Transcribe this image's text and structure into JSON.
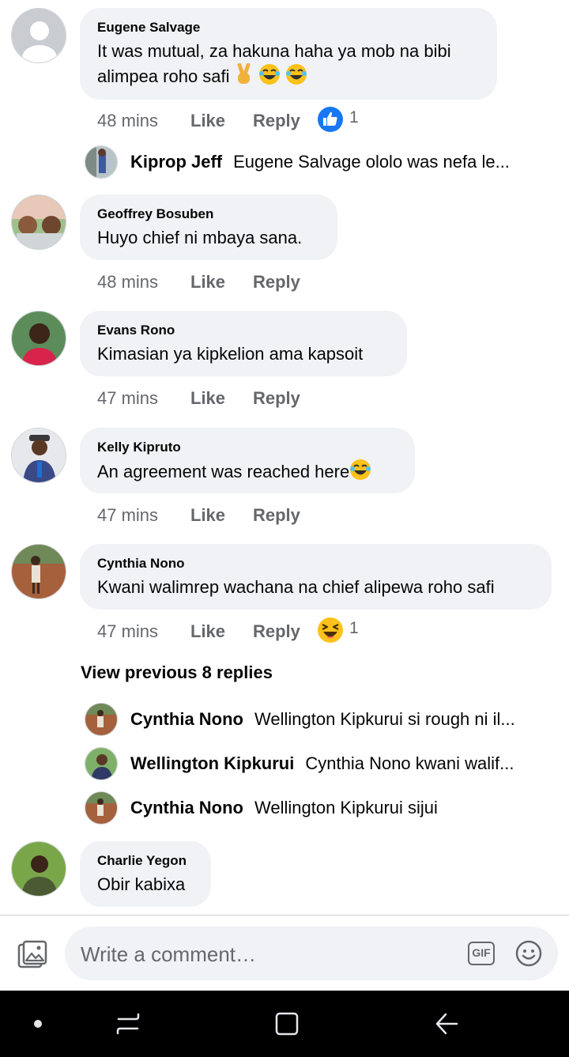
{
  "comments": [
    {
      "author": "Eugene Salvage",
      "text_line1": "It was mutual, za hakuna haha ya mob na bibi",
      "text_line2": "alimpea roho safi",
      "time": "48 mins",
      "like": "Like",
      "reply": "Reply",
      "reaction_count": "1",
      "reaction_icon": "thumbs-up-icon"
    },
    {
      "author": "Geoffrey Bosuben",
      "text": "Huyo chief ni mbaya sana.",
      "time": "48 mins",
      "like": "Like",
      "reply": "Reply"
    },
    {
      "author": "Evans Rono",
      "text": "Kimasian ya kipkelion ama kapsoit",
      "time": "47 mins",
      "like": "Like",
      "reply": "Reply"
    },
    {
      "author": "Kelly Kipruto",
      "text": "An agreement was reached here",
      "time": "47 mins",
      "like": "Like",
      "reply": "Reply"
    },
    {
      "author": "Cynthia Nono",
      "text": "Kwani walimrep wachana na chief alipewa roho safi",
      "time": "47 mins",
      "like": "Like",
      "reply": "Reply",
      "reaction_count": "1",
      "reaction_icon": "haha-icon"
    },
    {
      "author": "Charlie Yegon",
      "text": "Obir kabixa"
    }
  ],
  "replies_eugene": [
    {
      "author": "Kiprop Jeff",
      "text": "Eugene Salvage ololo was nefa le..."
    }
  ],
  "view_previous": "View previous 8 replies",
  "replies_cynthia": [
    {
      "author": "Cynthia Nono",
      "text": "Wellington Kipkurui si rough ni il..."
    },
    {
      "author": "Wellington Kipkurui",
      "text": "Cynthia Nono kwani walif..."
    },
    {
      "author": "Cynthia Nono",
      "text": "Wellington Kipkurui sijui"
    }
  ],
  "composer": {
    "placeholder": "Write a comment…",
    "gif_label": "GIF"
  },
  "colors": {
    "bubble": "#f0f2f5",
    "meta": "#65676b",
    "like_blue": "#1877f2",
    "emoji_yellow": "#fcc21b"
  }
}
